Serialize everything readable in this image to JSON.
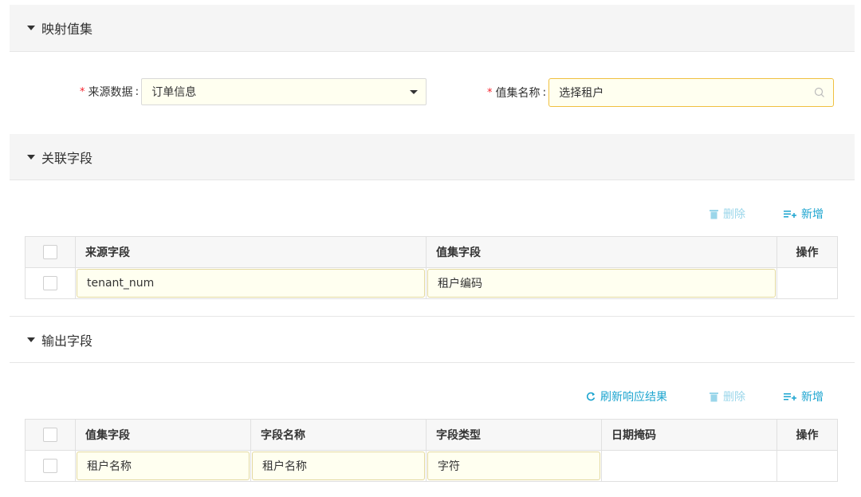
{
  "sections": {
    "mapping": {
      "title": "映射值集"
    },
    "association": {
      "title": "关联字段"
    },
    "output": {
      "title": "输出字段"
    }
  },
  "form": {
    "source_label": "来源数据",
    "source_value": "订单信息",
    "valueset_label": "值集名称",
    "valueset_value": "选择租户",
    "required_mark": "*",
    "colon": ":"
  },
  "toolbar": {
    "delete_label": "删除",
    "add_label": "新增",
    "refresh_label": "刷新响应结果"
  },
  "association_table": {
    "columns": [
      "来源字段",
      "值集字段",
      "操作"
    ],
    "rows": [
      {
        "source_field": "tenant_num",
        "valueset_field": "租户编码"
      }
    ]
  },
  "output_table": {
    "columns": [
      "值集字段",
      "字段名称",
      "字段类型",
      "日期掩码",
      "操作"
    ],
    "rows": [
      {
        "valueset_field": "租户名称",
        "field_name": "租户名称",
        "field_type": "字符",
        "date_mask": ""
      }
    ]
  },
  "colors": {
    "accent": "#1ba4cf",
    "accent_disabled": "#9ad6ea",
    "required": "#f5222d",
    "edit_bg": "#fffff0",
    "header_bg": "#f5f5f5"
  },
  "icons": [
    "caret-down-icon",
    "search-icon",
    "trash-icon",
    "add-list-icon",
    "refresh-icon"
  ]
}
